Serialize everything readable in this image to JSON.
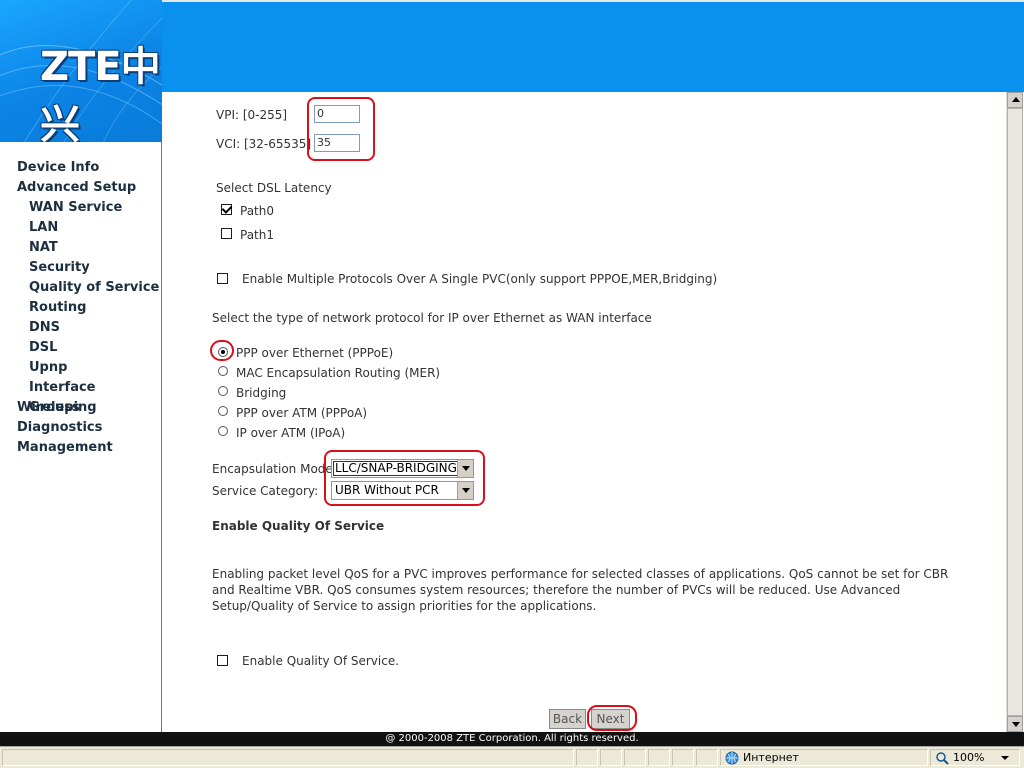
{
  "brand": {
    "logo_text": "ZTE中兴",
    "header_color": "#0a91f0"
  },
  "sidebar": {
    "items": [
      {
        "label": "Device Info",
        "level": 1
      },
      {
        "label": "Advanced Setup",
        "level": 1
      },
      {
        "label": "WAN Service",
        "level": 2
      },
      {
        "label": "LAN",
        "level": 2
      },
      {
        "label": "NAT",
        "level": 2
      },
      {
        "label": "Security",
        "level": 2
      },
      {
        "label": "Quality of Service",
        "level": 2
      },
      {
        "label": "Routing",
        "level": 2
      },
      {
        "label": "DNS",
        "level": 2
      },
      {
        "label": "DSL",
        "level": 2
      },
      {
        "label": "Upnp",
        "level": 2
      },
      {
        "label": "Interface Grouping",
        "level": 2
      },
      {
        "label": "Wireless",
        "level": 1
      },
      {
        "label": "Diagnostics",
        "level": 1
      },
      {
        "label": "Management",
        "level": 1
      }
    ]
  },
  "form": {
    "vpi_label": "VPI: [0-255]",
    "vpi_value": "0",
    "vci_label": "VCI: [32-65535]",
    "vci_value": "35",
    "latency_title": "Select DSL Latency",
    "path0_label": "Path0",
    "path0_checked": true,
    "path1_label": "Path1",
    "path1_checked": false,
    "multi_protocol_label": "Enable Multiple Protocols Over A Single PVC(only support PPPOE,MER,Bridging)",
    "multi_protocol_checked": false,
    "protocol_title": "Select the type of network protocol for IP over Ethernet as WAN interface",
    "protocols": [
      {
        "label": "PPP over Ethernet (PPPoE)",
        "checked": true
      },
      {
        "label": "MAC Encapsulation Routing (MER)",
        "checked": false
      },
      {
        "label": "Bridging",
        "checked": false
      },
      {
        "label": "PPP over ATM (PPPoA)",
        "checked": false
      },
      {
        "label": "IP over ATM (IPoA)",
        "checked": false
      }
    ],
    "encap_label": "Encapsulation Mode:",
    "encap_value": "LLC/SNAP-BRIDGING",
    "service_label": "Service Category:",
    "service_value": "UBR Without PCR",
    "qos_title": "Enable Quality Of Service",
    "qos_paragraph": "Enabling packet level QoS for a PVC improves performance for selected classes of applications. QoS cannot be set for CBR and Realtime VBR. QoS consumes system resources; therefore the number of PVCs will be reduced. Use Advanced Setup/Quality of Service to assign priorities for the applications.",
    "qos_enable_label": "Enable Quality Of Service.",
    "qos_enable_checked": false,
    "back_label": "Back",
    "next_label": "Next"
  },
  "footer": {
    "copyright": "@ 2000-2008 ZTE Corporation. All rights reserved."
  },
  "statusbar": {
    "zone": "Интернет",
    "zoom": "100%"
  },
  "colors": {
    "accent": "#0a91f0",
    "highlight_ring": "#d8101c",
    "nav_text": "#1c2f40"
  }
}
